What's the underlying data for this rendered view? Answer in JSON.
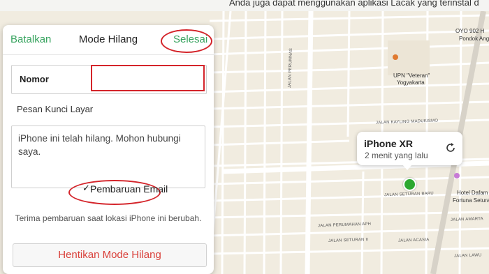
{
  "topbar": {
    "text": "Anda juga dapat menggunakan aplikasi Lacak yang terinstal d"
  },
  "panel": {
    "cancel_label": "Batalkan",
    "title": "Mode Hilang",
    "done_label": "Selesai",
    "number_label": "Nomor",
    "number_value": "",
    "lock_message_label": "Pesan Kunci Layar",
    "lock_message_value": "iPhone ini telah hilang. Mohon hubungi saya.",
    "email_check_mark": "✓",
    "email_updates_label": "Pembaruan Email",
    "email_updates_desc": "Terima pembaruan saat lokasi iPhone ini berubah.",
    "stop_button_label": "Hentikan Mode Hilang"
  },
  "device": {
    "name": "iPhone XR",
    "last_seen": "2 menit yang lalu",
    "dot_color": "#2ca82f"
  },
  "map": {
    "pois": {
      "oyo": "OYO 902 H",
      "pondok": "Pondok Ang",
      "upn_1": "UPN \"Veteran\"",
      "upn_2": "Yogyakarta",
      "hotel_1": "Hotel Dafam",
      "hotel_2": "Fortuna Seturan"
    },
    "roads": {
      "perumnas": "JALAN PERUMNAS",
      "kayling": "JALAN KAYLING MADUKISMO",
      "seturan_baru": "JALAN SETURAN BARU",
      "perumahan_aph": "JALAN PERUMAHAN APH",
      "seturan_ii": "JALAN SETURAN II",
      "acasia": "JALAN ACASIA",
      "amarta": "JALAN AMARTA",
      "lawu": "JALAN LAWU"
    }
  },
  "colors": {
    "accent_green": "#36a35e",
    "annotation_red": "#d4242a",
    "destructive": "#d9403a"
  }
}
